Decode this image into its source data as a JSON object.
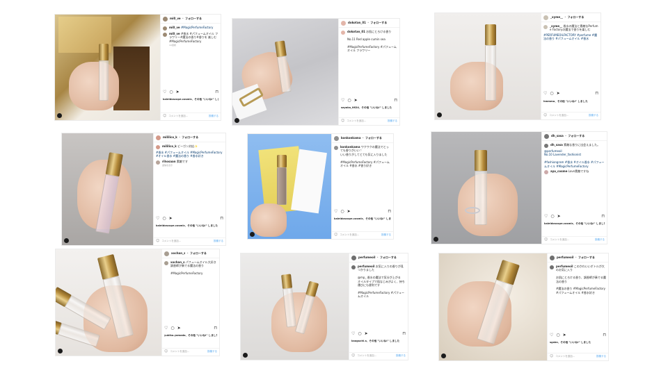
{
  "ui": {
    "follow": "フォローする",
    "add_comment": "コメントを追加...",
    "post_button": "投稿する"
  },
  "posts": [
    {
      "user": "mi0_ve",
      "comments": [
        {
          "user": "mi0_ve",
          "text": "#MagicPerfumeFactory"
        },
        {
          "user": "mi0_ve",
          "text": "#香水 #パフュームオイル フラワリー#魔法の香り#香りを 楽しむ#MagicPerfumeFactory"
        }
      ],
      "meta": "10週間",
      "likes": "kaleidoscope.cosmic、その他 \"いいね!\" しました",
      "date": ""
    },
    {
      "user": "dokotan_01",
      "comments": [
        {
          "user": "dokotan_01",
          "text": "お肌にとろける香り\n\nNo.11 Red apple cumin sea\n\n#MagicPerfumeFactory #パフュームオイル フラワリー"
        }
      ],
      "meta": "",
      "likes": "sayaka_0624、その他 \"いいね!\" しました",
      "date": ""
    },
    {
      "user": "_xyme__",
      "comments": [
        {
          "user": "_xyme__",
          "text": "香水の魔法と素敵なPerfume Factoryの魔法で香りを楽しむ"
        },
        {
          "user": "",
          "text": "#PERFUMEOILFACTORY #perfume #魔法の香り #パフュームオイル #香水"
        }
      ],
      "meta": "",
      "likes": "hmmmo、その他 \"いいね!\" しました",
      "date": ""
    },
    {
      "user": "mililico_k",
      "comments": [
        {
          "user": "mililico_k",
          "text": "ビーガン対応✨"
        },
        {
          "user": "",
          "text": "#香水 #パフュームオイル #MagicPerfumeFactory #オイル香水 #魔法の香り #香水好き"
        },
        {
          "user": "rihosaan",
          "text": "素敵です"
        }
      ],
      "meta": "返信を表示",
      "likes": "kaleidoscope.cosmic、その他 \"いいね!\" しました",
      "date": ""
    },
    {
      "user": "konkonkama",
      "comments": [
        {
          "user": "konkonkama",
          "text": "ワクワクの魔法でとっても香りがいい♡\nいい香りがしてとても気に入りました\n\n#MagicPerfumeFactory #パフュームオイル #香水 #香り好き"
        }
      ],
      "meta": "",
      "likes": "kaleidoscope.cosmic、その他 \"いいね!\" しました",
      "date": ""
    },
    {
      "user": "dh_sasa",
      "comments": [
        {
          "user": "dh_sasa",
          "text": "素敵な香りに出会えました。"
        },
        {
          "user": "",
          "text": "@perfumeoil\nNo.10 Lavender_fashionist\n\n#fashiongram #香水 #オイル香水 #パフュームオイル #MagicPerfumeFactory"
        },
        {
          "user": "ayu_cosme",
          "text": "Love素敵ですね"
        }
      ],
      "meta": "",
      "likes": "kaleidoscope.cosmic、その他 \"いいね!\" しました",
      "date": ""
    },
    {
      "user": "xochan_s",
      "comments": [
        {
          "user": "xochan_s",
          "text": "パフュームオイル大好き 調香師が奏でる魔法の香り\n\n#MagicPerfumeFactory"
        }
      ],
      "meta": "",
      "likes": "yukiko.yamada、その他 \"いいね!\" しました",
      "date": ""
    },
    {
      "user": "perfumeoil",
      "comments": [
        {
          "user": "perfumeoil",
          "text": "お気に入りの香りが見つかりました\n\n@mp_ 香水の魔法で気分が上がる\nオイルタイプで肌なじみがよく、持ち運びにも便利です\n\n#MagicPerfumeFactory #パフュームオイル"
        }
      ],
      "meta": "",
      "likes": "kaoguchi.s、その他 \"いいね!\" しました",
      "date": ""
    },
    {
      "user": "perfumeoil",
      "comments": [
        {
          "user": "perfumeoil",
          "text": "このかわいいボトルが大のお気に入り\n\nお肌にとろける香り、調香師が奏でる魔法の香り\n\n#魔法の香り #MagicPerfumeFactory #パフュームオイル #香水好き"
        }
      ],
      "meta": "",
      "likes": "sgskn、その他 \"いいね!\" しました",
      "date": ""
    }
  ]
}
